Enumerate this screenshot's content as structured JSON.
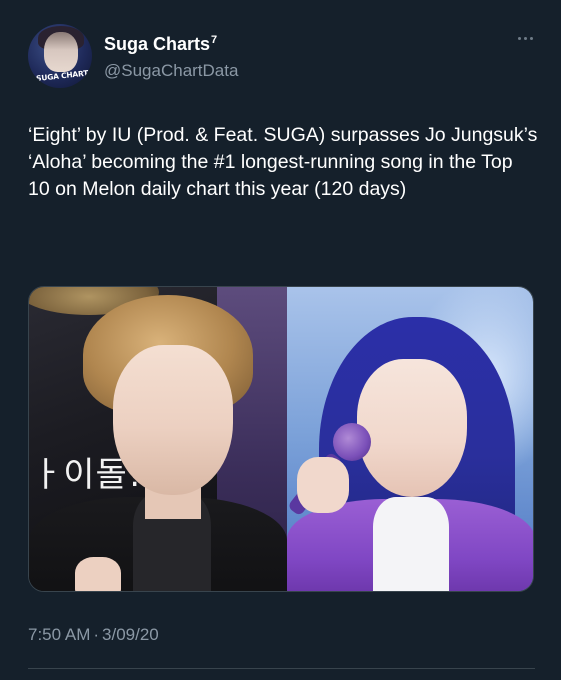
{
  "author": {
    "display_name": "Suga Charts",
    "display_name_superscript": "7",
    "handle": "@SugaChartData",
    "avatar_badge_text": "SUGA CHARTS"
  },
  "tweet": {
    "text": "‘Eight’ by IU (Prod. & Feat. SUGA) surpasses Jo Jungsuk’s ‘Aloha’ becoming the #1 longest-running song in the Top 10 on Melon daily chart this year (120 days)",
    "media": {
      "left_image_sign_text": "ㅏ이돌!",
      "left_image_icon": "photo-suga-icon",
      "right_image_icon": "photo-iu-icon"
    },
    "time": "7:50 AM",
    "separator": "·",
    "date": "3/09/20"
  },
  "icons": {
    "more": "more-options-icon"
  },
  "colors": {
    "background": "#15202b",
    "text_primary": "#ffffff",
    "text_secondary": "#8b98a5",
    "border": "#38444d"
  }
}
